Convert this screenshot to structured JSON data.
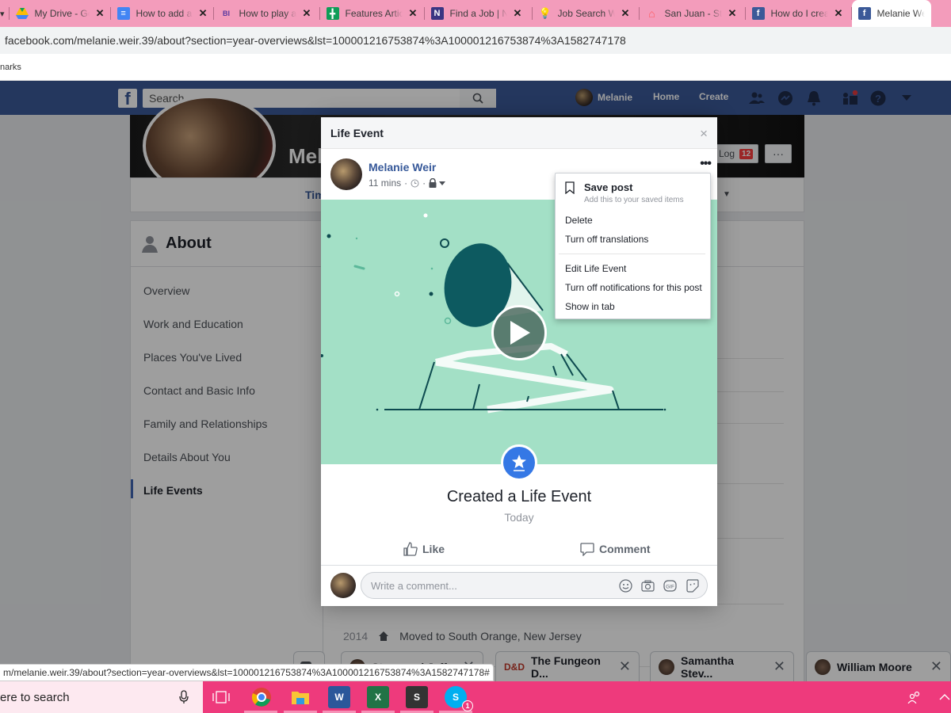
{
  "browser": {
    "tabs": [
      {
        "label": "My Drive - Google Drive",
        "icon": "google-drive-icon",
        "color": "#1fa463"
      },
      {
        "label": "How to add a",
        "icon": "google-docs-icon",
        "color": "#4285f4"
      },
      {
        "label": "How to play a",
        "icon": "bi-icon",
        "color": "#5b3aa0"
      },
      {
        "label": "Features Article",
        "icon": "google-sheets-icon",
        "color": "#0f9d58"
      },
      {
        "label": "Find a Job | N",
        "icon": "onenote-icon",
        "color": "#3a3582"
      },
      {
        "label": "Job Search W",
        "icon": "lightbulb-icon",
        "color": "#1b84d8"
      },
      {
        "label": "San Juan - Sta",
        "icon": "airbnb-icon",
        "color": "#ff5a5f"
      },
      {
        "label": "How do I crea",
        "icon": "facebook-icon",
        "color": "#3b5998"
      },
      {
        "label": "Melanie We",
        "icon": "facebook-icon",
        "color": "#3b5998",
        "active": true
      }
    ],
    "address": "facebook.com/melanie.weir.39/about?section=year-overviews&lst=100001216753874%3A100001216753874%3A1582747178",
    "bookmarks_label": "narks",
    "status_url": "m/melanie.weir.39/about?section=year-overviews&lst=100001216753874%3A100001216753874%3A1582747178#"
  },
  "fb": {
    "search_placeholder": "Search",
    "user_name": "Melanie",
    "nav": {
      "home": "Home",
      "create": "Create"
    },
    "colors": {
      "brand": "#3b5998",
      "accent": "#365899",
      "event": "#3578e5",
      "media_bg": "#a3e0c6",
      "media_dark": "#0d5a60"
    }
  },
  "profile": {
    "name_partial": "Mel",
    "timeline_partial": "Tim",
    "activity_log": "Log",
    "activity_badge": "12",
    "more": "···"
  },
  "about": {
    "title": "About",
    "items": [
      {
        "label": "Overview"
      },
      {
        "label": "Work and Education"
      },
      {
        "label": "Places You've Lived"
      },
      {
        "label": "Contact and Basic Info"
      },
      {
        "label": "Family and Relationships"
      },
      {
        "label": "Details About You"
      },
      {
        "label": "Life Events",
        "active": true
      }
    ],
    "year_event": {
      "year": "2014",
      "text": "Moved to South Orange, New Jersey"
    }
  },
  "modal": {
    "title": "Life Event",
    "close": "×",
    "author": "Melanie Weir",
    "time": "11 mins",
    "more": "•••",
    "event_title": "Created a Life Event",
    "event_date": "Today",
    "like": "Like",
    "comment": "Comment",
    "comment_placeholder": "Write a comment..."
  },
  "menu": {
    "save_title": "Save post",
    "save_subtitle": "Add this to your saved items",
    "items_group1": [
      "Delete",
      "Turn off translations"
    ],
    "items_group2": [
      "Edit Life Event",
      "Turn off notifications for this post",
      "Show in tab"
    ]
  },
  "chats": [
    {
      "label": "Steve and Jeff",
      "partial": true
    },
    {
      "label": "The Fungeon D...",
      "icon": "dnd-icon"
    },
    {
      "label": "Samantha Stev..."
    },
    {
      "label": "William Moore"
    }
  ],
  "taskbar": {
    "search_partial": "ere to search",
    "skype_badge": "1"
  }
}
